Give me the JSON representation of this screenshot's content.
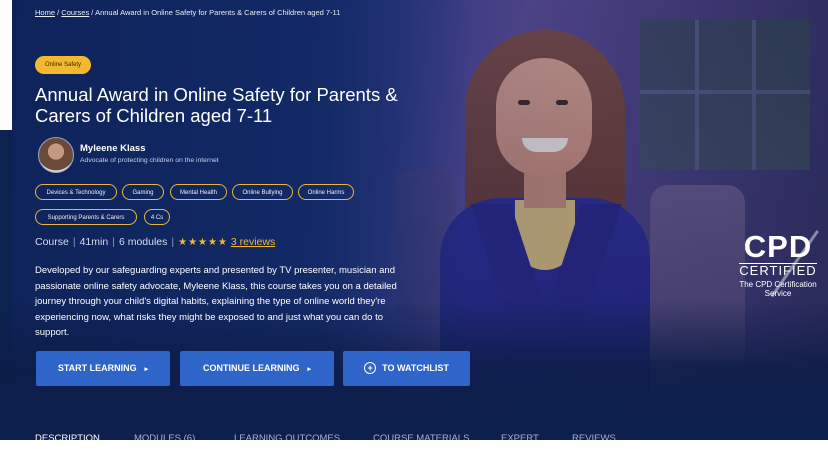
{
  "breadcrumb": {
    "home": "Home",
    "sep1": " / ",
    "courses": "Courses",
    "sep2": " / ",
    "current": "Annual Award in Online Safety for Parents & Carers of Children aged 7-11"
  },
  "category_badge": "Online Safety",
  "title": "Annual Award in Online Safety for Parents & Carers of Children aged 7-11",
  "author": {
    "name": "Myleene Klass",
    "role": "Advocate of protecting children on the internet"
  },
  "tags": [
    "Devices & Technology",
    "Gaming",
    "Mental Health",
    "Online Bullying",
    "Online Harms",
    "Supporting Parents & Carers",
    "4 Cs"
  ],
  "meta": {
    "type": "Course",
    "duration": "41min",
    "modules": "6 modules",
    "stars": "★★★★★",
    "rating_stars": 5,
    "reviews": "3 reviews",
    "separator": "|"
  },
  "description": "Developed by our safeguarding experts and presented by TV presenter, musician and passionate online safety advocate, Myleene Klass, this course takes you on a detailed journey through your child's digital habits, explaining the type of online world they're experiencing now, what risks they might be exposed to and just what you can do to support.",
  "buttons": {
    "start": "START LEARNING",
    "continue": "CONTINUE LEARNING",
    "watchlist": "TO WATCHLIST",
    "arrow": "▸",
    "plus": "+"
  },
  "tabs": [
    "DESCRIPTION",
    "MODULES (6)",
    "LEARNING OUTCOMES",
    "COURSE MATERIALS",
    "EXPERT",
    "REVIEWS"
  ],
  "cpd": {
    "big": "CPD",
    "certified": "CERTIFIED",
    "line1": "The CPD Certification",
    "line2": "Service"
  },
  "colors": {
    "accent": "#f2b830",
    "button": "#2f64c8",
    "hero": "#0f2a66"
  }
}
